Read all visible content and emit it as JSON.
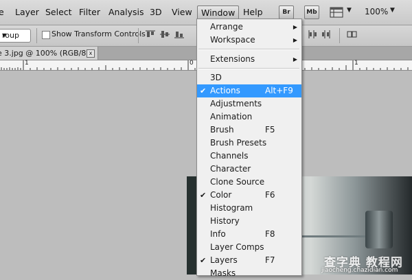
{
  "menubar": {
    "items": [
      "e",
      "Layer",
      "Select",
      "Filter",
      "Analysis",
      "3D",
      "View",
      "Window",
      "Help"
    ],
    "bridge_button": "Br",
    "minibridge_button": "Mb",
    "zoom": "100%"
  },
  "options": {
    "autoselect_value": "roup",
    "show_transform_label": "Show Transform Controls"
  },
  "document": {
    "tab_title": "e 3.jpg @ 100% (RGB/8)",
    "close_glyph": "x"
  },
  "ruler": {
    "labels": [
      "1",
      "0",
      "1"
    ]
  },
  "window_menu": {
    "items": [
      {
        "label": "Arrange",
        "submenu": true
      },
      {
        "label": "Workspace",
        "submenu": true
      },
      {
        "label": "Extensions",
        "submenu": true
      },
      {
        "label": "3D"
      },
      {
        "label": "Actions",
        "shortcut": "Alt+F9",
        "checked": true,
        "highlighted": true
      },
      {
        "label": "Adjustments"
      },
      {
        "label": "Animation"
      },
      {
        "label": "Brush",
        "shortcut": "F5"
      },
      {
        "label": "Brush Presets"
      },
      {
        "label": "Channels"
      },
      {
        "label": "Character"
      },
      {
        "label": "Clone Source"
      },
      {
        "label": "Color",
        "shortcut": "F6",
        "checked": true
      },
      {
        "label": "Histogram"
      },
      {
        "label": "History"
      },
      {
        "label": "Info",
        "shortcut": "F8"
      },
      {
        "label": "Layer Comps"
      },
      {
        "label": "Layers",
        "shortcut": "F7",
        "checked": true
      },
      {
        "label": "Masks"
      }
    ]
  },
  "watermark": {
    "title": "查字典 教程网",
    "url": "jiaocheng.chazidian.com"
  },
  "colors": {
    "menu_highlight": "#3399ff",
    "background": "#bdbdbd"
  },
  "icons": {
    "check": "✔",
    "submenu_arrow": "▶",
    "dropdown_arrow": "▼"
  }
}
